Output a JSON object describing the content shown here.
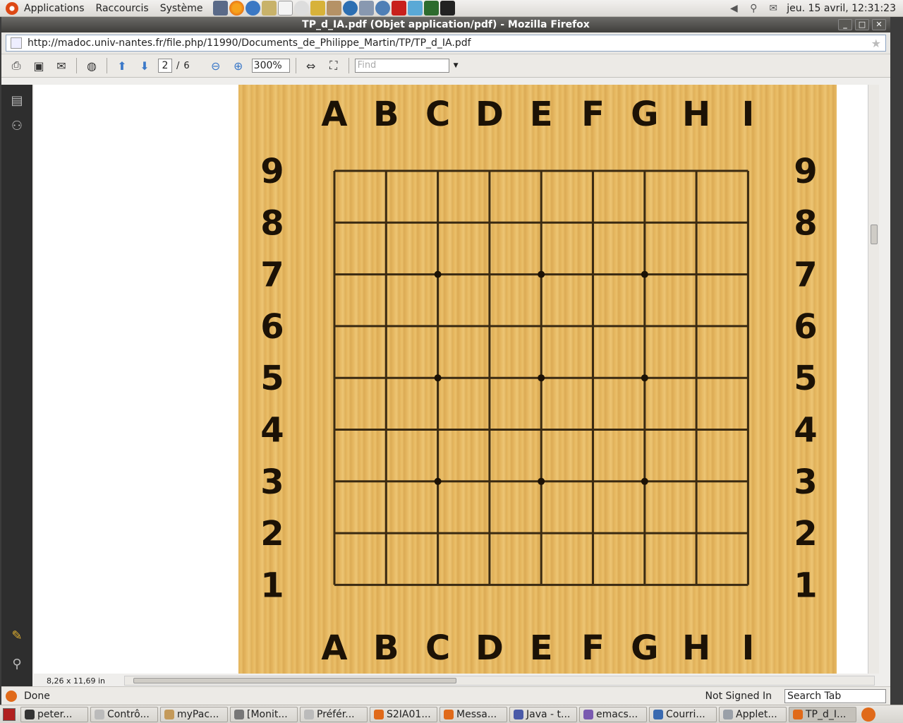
{
  "top_panel": {
    "menus": [
      "Applications",
      "Raccourcis",
      "Système"
    ],
    "clock": "jeu. 15 avril, 12:31:23"
  },
  "window": {
    "title": "TP_d_IA.pdf (Objet application/pdf) - Mozilla Firefox",
    "url": "http://madoc.univ-nantes.fr/file.php/11990/Documents_de_Philippe_Martin/TP/TP_d_IA.pdf"
  },
  "pdf_toolbar": {
    "current_page": "2",
    "page_separator": "/",
    "total_pages": "6",
    "zoom": "300%",
    "find_placeholder": "Find"
  },
  "document": {
    "page_size": "8,26 x 11,69 in",
    "board": {
      "columns": [
        "A",
        "B",
        "C",
        "D",
        "E",
        "F",
        "G",
        "H",
        "I"
      ],
      "rows": [
        "9",
        "8",
        "7",
        "6",
        "5",
        "4",
        "3",
        "2",
        "1"
      ],
      "star_points": [
        "C7",
        "E7",
        "G7",
        "C5",
        "E5",
        "G5",
        "C3",
        "E3",
        "G3"
      ]
    }
  },
  "firefox_status": {
    "status": "Done",
    "sign_in": "Not Signed In",
    "search_tab": "Search Tab"
  },
  "taskbar": {
    "items": [
      {
        "label": "peter...",
        "color": "#333333"
      },
      {
        "label": "Contrô...",
        "color": "#bbbbbb"
      },
      {
        "label": "myPac...",
        "color": "#c49a5a"
      },
      {
        "label": "[Monit...",
        "color": "#777777"
      },
      {
        "label": "Préfér...",
        "color": "#bbbbbb"
      },
      {
        "label": "S2IA01...",
        "color": "#e06a1a"
      },
      {
        "label": "Messa...",
        "color": "#e06a1a"
      },
      {
        "label": "Java - t...",
        "color": "#4a5aa8"
      },
      {
        "label": "emacs...",
        "color": "#7a5ab0"
      },
      {
        "label": "Courri...",
        "color": "#3a6ab0"
      },
      {
        "label": "Applet...",
        "color": "#9aa0a8"
      },
      {
        "label": "TP_d_I...",
        "color": "#e06a1a"
      }
    ]
  }
}
